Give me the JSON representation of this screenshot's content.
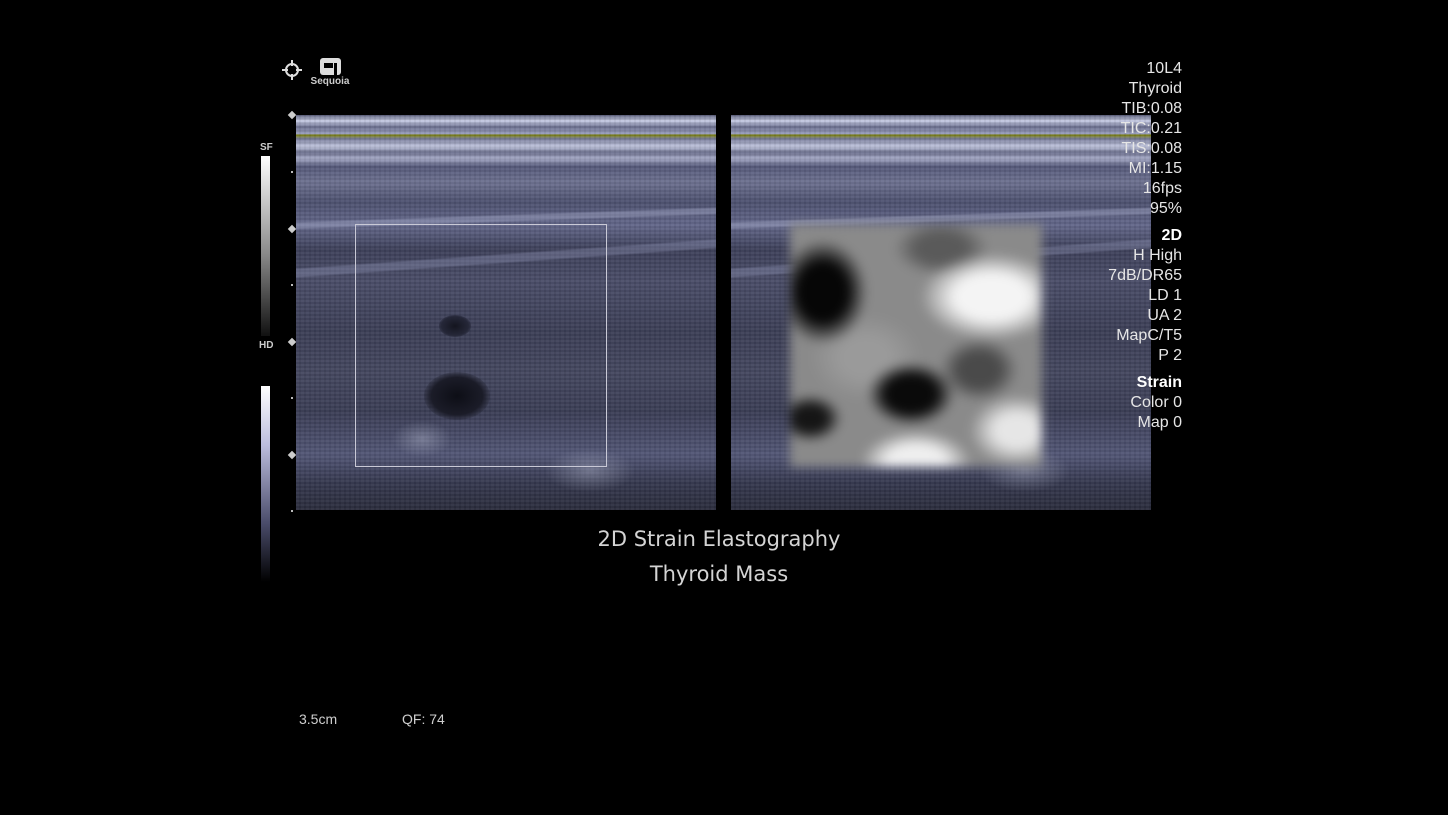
{
  "brand": {
    "logo_text": "Sequoia",
    "icons": [
      "crosshair-icon",
      "sequoia-logo-icon"
    ]
  },
  "scale_bars": {
    "top_label": "SF",
    "bottom_label": "HD"
  },
  "params": {
    "transducer": "10L4",
    "preset": "Thyroid",
    "tib": "TIB:0.08",
    "tic": "TIC:0.21",
    "tis": "TIS:0.08",
    "mi": "MI:1.15",
    "frame_rate": "16fps",
    "power": "95%",
    "mode_2d": {
      "header": "2D",
      "items": [
        "H High",
        "7dB/DR65",
        "LD 1",
        "UA 2",
        "MapC/T5",
        "P 2"
      ]
    },
    "mode_strain": {
      "header": "Strain",
      "items": [
        "Color 0",
        "Map 0"
      ]
    }
  },
  "caption": {
    "line1": "2D Strain Elastography",
    "line2": "Thyroid Mass"
  },
  "footer": {
    "depth": "3.5cm",
    "qf": "QF: 74"
  },
  "colors": {
    "background": "#000000",
    "text": "#e6e6e6",
    "roi_border": "#c9c9d6"
  }
}
